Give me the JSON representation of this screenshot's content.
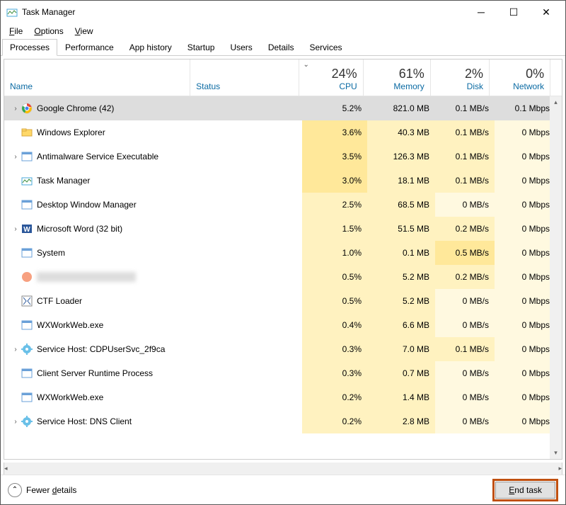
{
  "window": {
    "title": "Task Manager"
  },
  "menubar": [
    "File",
    "Options",
    "View"
  ],
  "tabs": [
    "Processes",
    "Performance",
    "App history",
    "Startup",
    "Users",
    "Details",
    "Services"
  ],
  "active_tab": 0,
  "columns": {
    "name": "Name",
    "status": "Status",
    "cpu": {
      "label": "CPU",
      "value": "24%"
    },
    "memory": {
      "label": "Memory",
      "value": "61%"
    },
    "disk": {
      "label": "Disk",
      "value": "2%"
    },
    "network": {
      "label": "Network",
      "value": "0%"
    }
  },
  "processes": [
    {
      "icon": "chrome",
      "name": "Google Chrome (42)",
      "expandable": true,
      "selected": true,
      "cpu": "5.2%",
      "mem": "821.0 MB",
      "disk": "0.1 MB/s",
      "net": "0.1 Mbps"
    },
    {
      "icon": "folder",
      "name": "Windows Explorer",
      "expandable": false,
      "cpu": "3.6%",
      "mem": "40.3 MB",
      "disk": "0.1 MB/s",
      "net": "0 Mbps"
    },
    {
      "icon": "generic",
      "name": "Antimalware Service Executable",
      "expandable": true,
      "cpu": "3.5%",
      "mem": "126.3 MB",
      "disk": "0.1 MB/s",
      "net": "0 Mbps"
    },
    {
      "icon": "taskmgr",
      "name": "Task Manager",
      "expandable": false,
      "cpu": "3.0%",
      "mem": "18.1 MB",
      "disk": "0.1 MB/s",
      "net": "0 Mbps"
    },
    {
      "icon": "generic",
      "name": "Desktop Window Manager",
      "expandable": false,
      "cpu": "2.5%",
      "mem": "68.5 MB",
      "disk": "0 MB/s",
      "net": "0 Mbps"
    },
    {
      "icon": "word",
      "name": "Microsoft Word (32 bit)",
      "expandable": true,
      "cpu": "1.5%",
      "mem": "51.5 MB",
      "disk": "0.2 MB/s",
      "net": "0 Mbps"
    },
    {
      "icon": "generic",
      "name": "System",
      "expandable": false,
      "cpu": "1.0%",
      "mem": "0.1 MB",
      "disk": "0.5 MB/s",
      "net": "0 Mbps"
    },
    {
      "icon": "blurred",
      "name": "",
      "blurred": true,
      "expandable": false,
      "cpu": "0.5%",
      "mem": "5.2 MB",
      "disk": "0.2 MB/s",
      "net": "0 Mbps"
    },
    {
      "icon": "ctf",
      "name": "CTF Loader",
      "expandable": false,
      "cpu": "0.5%",
      "mem": "5.2 MB",
      "disk": "0 MB/s",
      "net": "0 Mbps"
    },
    {
      "icon": "generic",
      "name": "WXWorkWeb.exe",
      "expandable": false,
      "cpu": "0.4%",
      "mem": "6.6 MB",
      "disk": "0 MB/s",
      "net": "0 Mbps"
    },
    {
      "icon": "service",
      "name": "Service Host: CDPUserSvc_2f9ca",
      "expandable": true,
      "cpu": "0.3%",
      "mem": "7.0 MB",
      "disk": "0.1 MB/s",
      "net": "0 Mbps"
    },
    {
      "icon": "generic",
      "name": "Client Server Runtime Process",
      "expandable": false,
      "cpu": "0.3%",
      "mem": "0.7 MB",
      "disk": "0 MB/s",
      "net": "0 Mbps"
    },
    {
      "icon": "generic",
      "name": "WXWorkWeb.exe",
      "expandable": false,
      "cpu": "0.2%",
      "mem": "1.4 MB",
      "disk": "0 MB/s",
      "net": "0 Mbps"
    },
    {
      "icon": "service",
      "name": "Service Host: DNS Client",
      "expandable": true,
      "cpu": "0.2%",
      "mem": "2.8 MB",
      "disk": "0 MB/s",
      "net": "0 Mbps"
    }
  ],
  "footer": {
    "fewer": "Fewer details",
    "endtask": "End task"
  }
}
